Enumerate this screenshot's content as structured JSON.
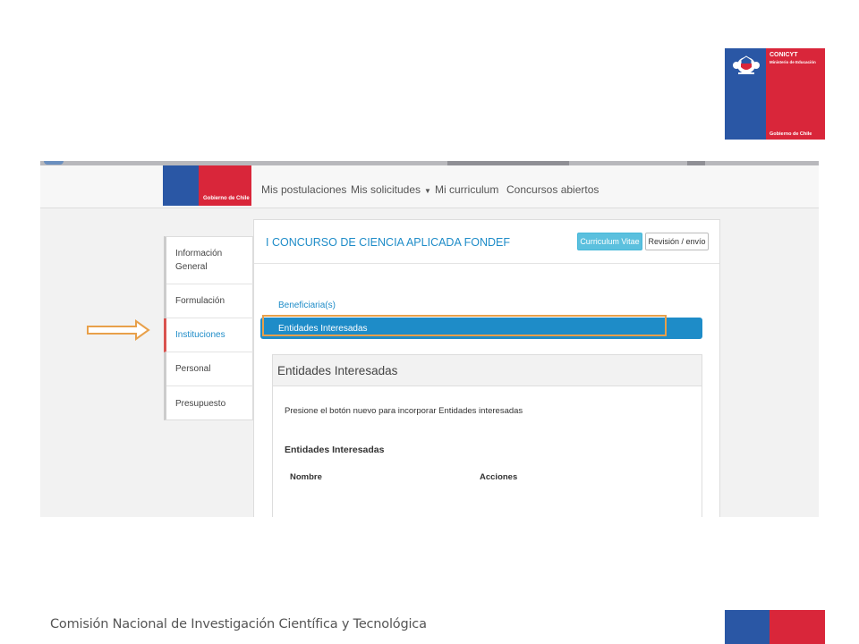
{
  "logo": {
    "brand": "CONICYT",
    "ministry": "Ministerio de Educación",
    "government": "Gobierno de Chile"
  },
  "nav": {
    "logo_text": "Gobierno de Chile",
    "items": [
      "Mis postulaciones",
      "Mis solicitudes",
      "Mi curriculum",
      "Concursos abiertos"
    ]
  },
  "sidebar": {
    "items": [
      {
        "label": "Información General"
      },
      {
        "label": "Formulación"
      },
      {
        "label": "Instituciones"
      },
      {
        "label": "Personal"
      },
      {
        "label": "Presupuesto"
      }
    ]
  },
  "panel": {
    "title": "I CONCURSO DE CIENCIA APLICADA FONDEF",
    "cv_button": "Curriculum Vitae",
    "review_button": "Revisión / envío",
    "tabs": [
      "Beneficiaria(s)",
      "Entidades Interesadas"
    ]
  },
  "card": {
    "title": "Entidades Interesadas",
    "hint": "Presione el botón nuevo para incorporar Entidades interesadas",
    "subtitle": "Entidades Interesadas",
    "columns": [
      "Nombre",
      "Acciones"
    ]
  },
  "footer": {
    "text": "Comisión Nacional de Investigación Científica y Tecnológica"
  },
  "colors": {
    "gov_blue": "#2a57a5",
    "gov_red": "#d9263a",
    "accent": "#1e8cc8",
    "highlight": "#e8a04a"
  }
}
